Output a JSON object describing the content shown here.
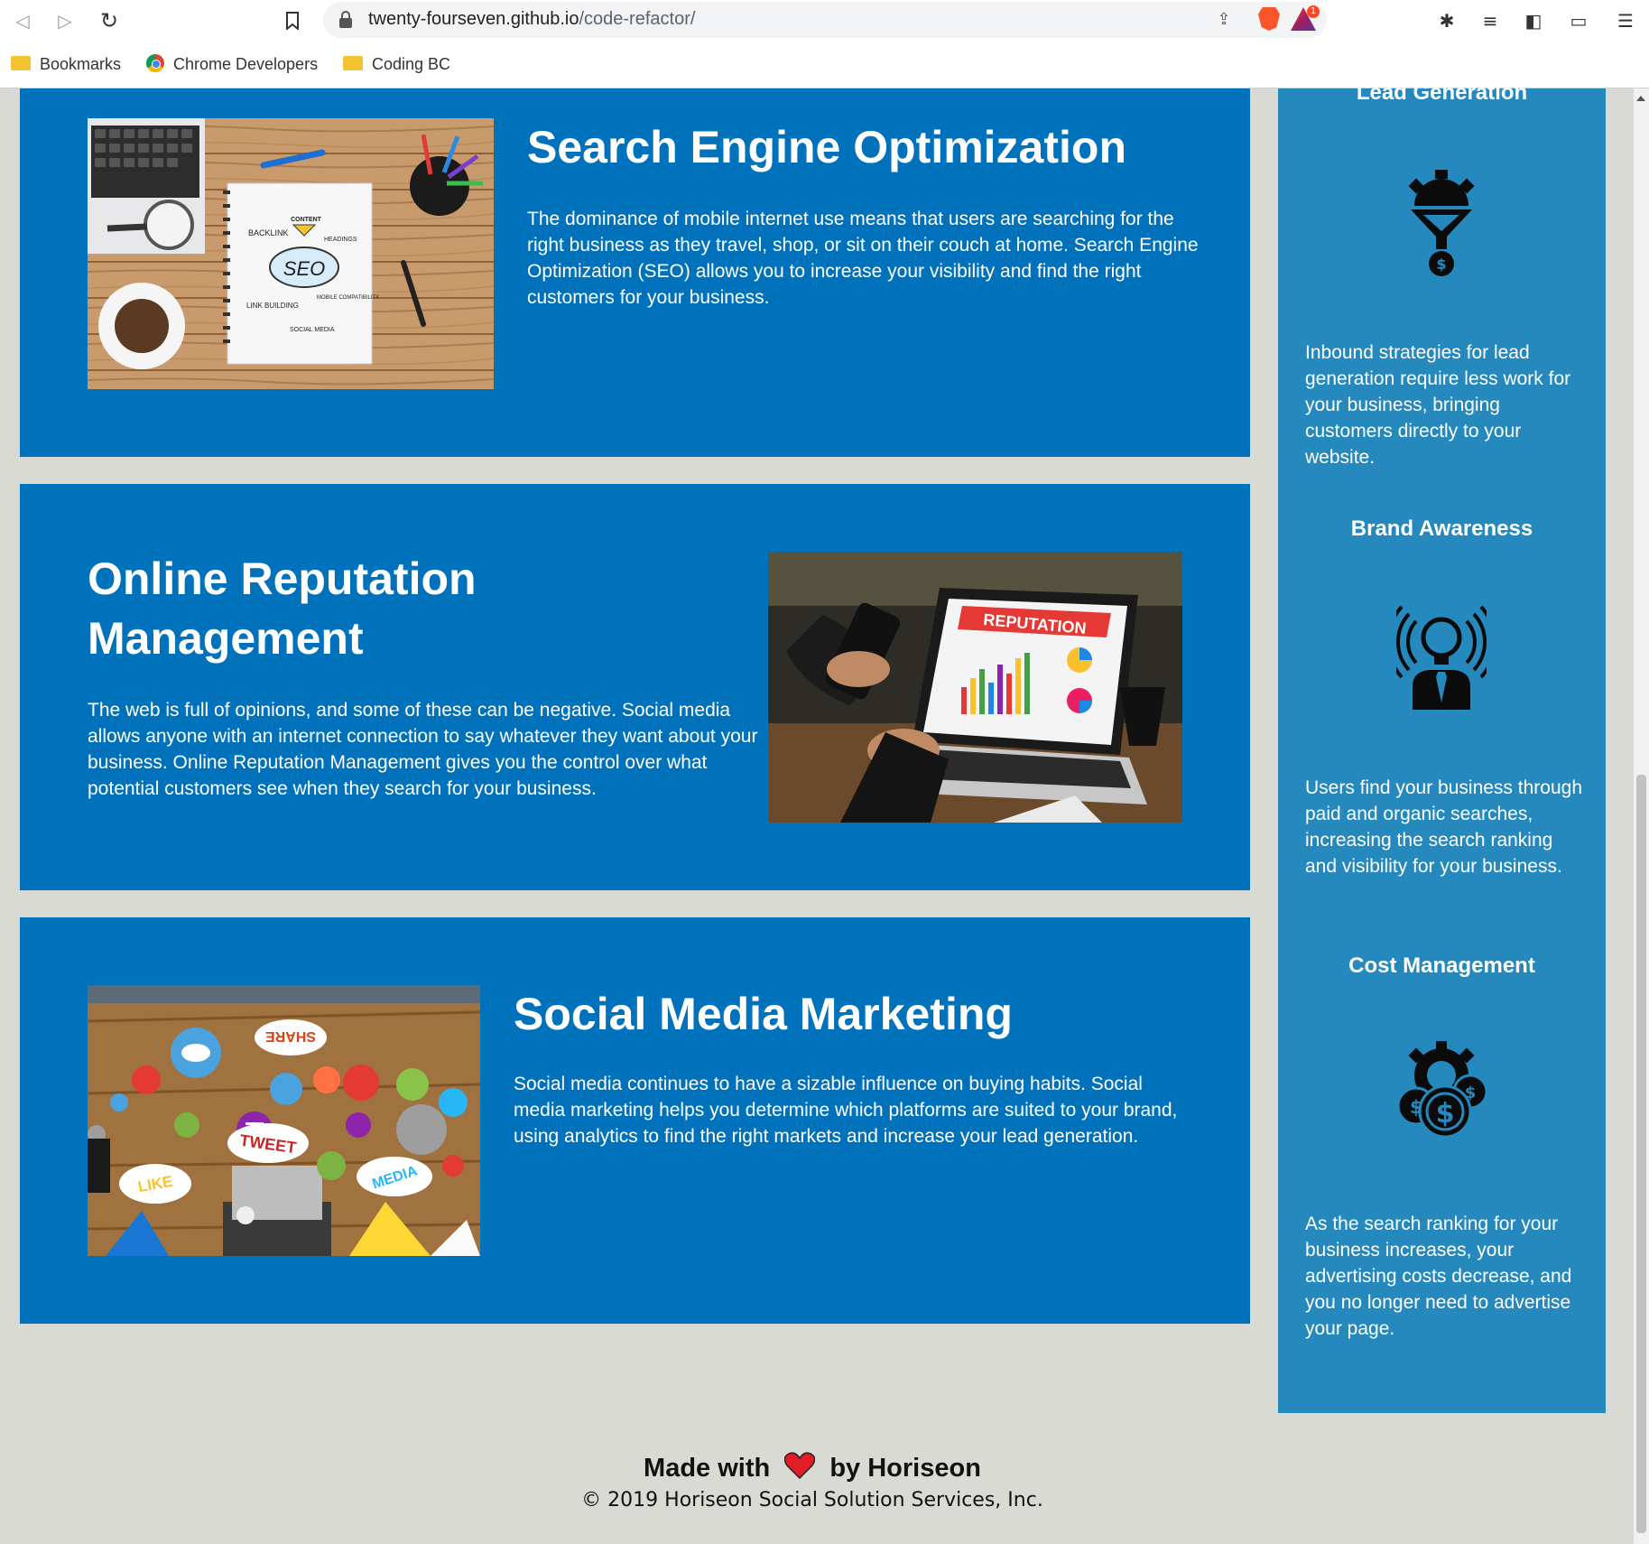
{
  "browser": {
    "url_host": "twenty-fourseven.github.io",
    "url_path": "/code-refactor/",
    "rewards_badge": "1",
    "bookmarks": [
      {
        "label": "Bookmarks",
        "icon": "folder-icon"
      },
      {
        "label": "Chrome Developers",
        "icon": "chrome-icon"
      },
      {
        "label": "Coding BC",
        "icon": "folder-icon"
      }
    ]
  },
  "services": [
    {
      "title": "Search Engine Optimization",
      "text": "The dominance of mobile internet use means that users are searching for the right business as they travel, shop, or sit on their couch at home. Search Engine Optimization (SEO) allows you to increase your visibility and find the right customers for your business.",
      "image_labels": [
        "CONTENT",
        "BACKLINK",
        "HEADINGS",
        "SEO",
        "LINK BUILDING",
        "MOBILE COMPATIBILITY",
        "SOCIAL MEDIA"
      ]
    },
    {
      "title": "Online Reputation Management",
      "text": "The web is full of opinions, and some of these can be negative. Social media allows anyone with an internet connection to say whatever they want about your business. Online Reputation Management gives you the control over what potential customers see when they search for your business.",
      "image_labels": [
        "REPUTATION"
      ]
    },
    {
      "title": "Social Media Marketing",
      "text": "Social media continues to have a sizable influence on buying habits. Social media marketing helps you determine which platforms are suited to your brand, using analytics to find the right markets and increase your lead generation.",
      "image_labels": [
        "SHARE",
        "TWEET",
        "LIKE",
        "MEDIA"
      ]
    }
  ],
  "benefits": [
    {
      "title": "Lead Generation",
      "icon": "lead-generation-icon",
      "text": "Inbound strategies for lead generation require less work for your business, bringing customers directly to your website."
    },
    {
      "title": "Brand Awareness",
      "icon": "brand-awareness-icon",
      "text": "Users find your business through paid and organic searches, increasing the search ranking and visibility for your business."
    },
    {
      "title": "Cost Management",
      "icon": "cost-management-icon",
      "text": "As the search ranking for your business increases, your advertising costs decrease, and you no longer need to advertise your page."
    }
  ],
  "footer": {
    "made_with": "Made with",
    "by": "by Horiseon",
    "copyright": "© 2019 Horiseon Social Solution Services, Inc."
  },
  "colors": {
    "service_bg": "#0072bb",
    "benefits_bg": "#2589bd",
    "page_bg": "#d9dad4",
    "heart": "#e21d27"
  }
}
